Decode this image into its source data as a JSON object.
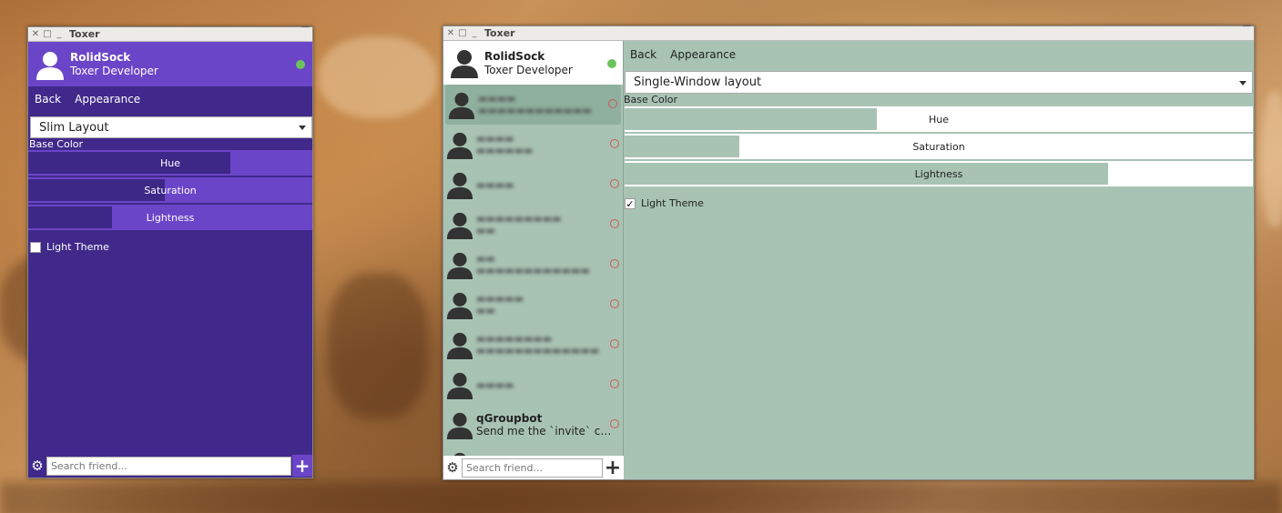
{
  "left_window": {
    "title": "Toxer",
    "profile": {
      "name": "RolidSock",
      "status_message": "Toxer Developer"
    },
    "nav": {
      "back": "Back",
      "appearance": "Appearance"
    },
    "layout_select": "Slim Layout",
    "base_color_label": "Base Color",
    "sliders": [
      {
        "label": "Hue",
        "level": 0.72
      },
      {
        "label": "Saturation",
        "level": 0.5
      },
      {
        "label": "Lightness",
        "level": 0.3
      }
    ],
    "light_theme": {
      "label": "Light Theme",
      "checked": false
    },
    "search_placeholder": "Search friend...",
    "colors": {
      "header": "#6b45c8",
      "body": "#40298a",
      "accent": "#6b45c8"
    }
  },
  "right_window": {
    "title": "Toxer",
    "profile": {
      "name": "RolidSock",
      "status_message": "Toxer Developer"
    },
    "nav": {
      "back": "Back",
      "appearance": "Appearance"
    },
    "layout_select": "Single-Window layout",
    "base_color_label": "Base Color",
    "sliders": [
      {
        "label": "Hue",
        "level": 0.4
      },
      {
        "label": "Saturation",
        "level": 0.18
      },
      {
        "label": "Lightness",
        "level": 0.77
      }
    ],
    "light_theme": {
      "label": "Light Theme",
      "checked": true,
      "check_mark": "✓"
    },
    "friends": [
      {
        "name": "",
        "message": "",
        "active": true
      },
      {
        "name": "",
        "message": ""
      },
      {
        "name": "",
        "message": ""
      },
      {
        "name": "",
        "message": ""
      },
      {
        "name": "",
        "message": ""
      },
      {
        "name": "",
        "message": ""
      },
      {
        "name": "",
        "message": ""
      },
      {
        "name": "",
        "message": ""
      },
      {
        "name": "qGroupbot",
        "message": "Send me the `invite` co…"
      }
    ],
    "search_placeholder": "Search friend...",
    "colors": {
      "background": "#a8c3b4",
      "slider_fill": "#a8c3b4",
      "online": "#6bc25a",
      "offline": "#c85a5a"
    }
  }
}
